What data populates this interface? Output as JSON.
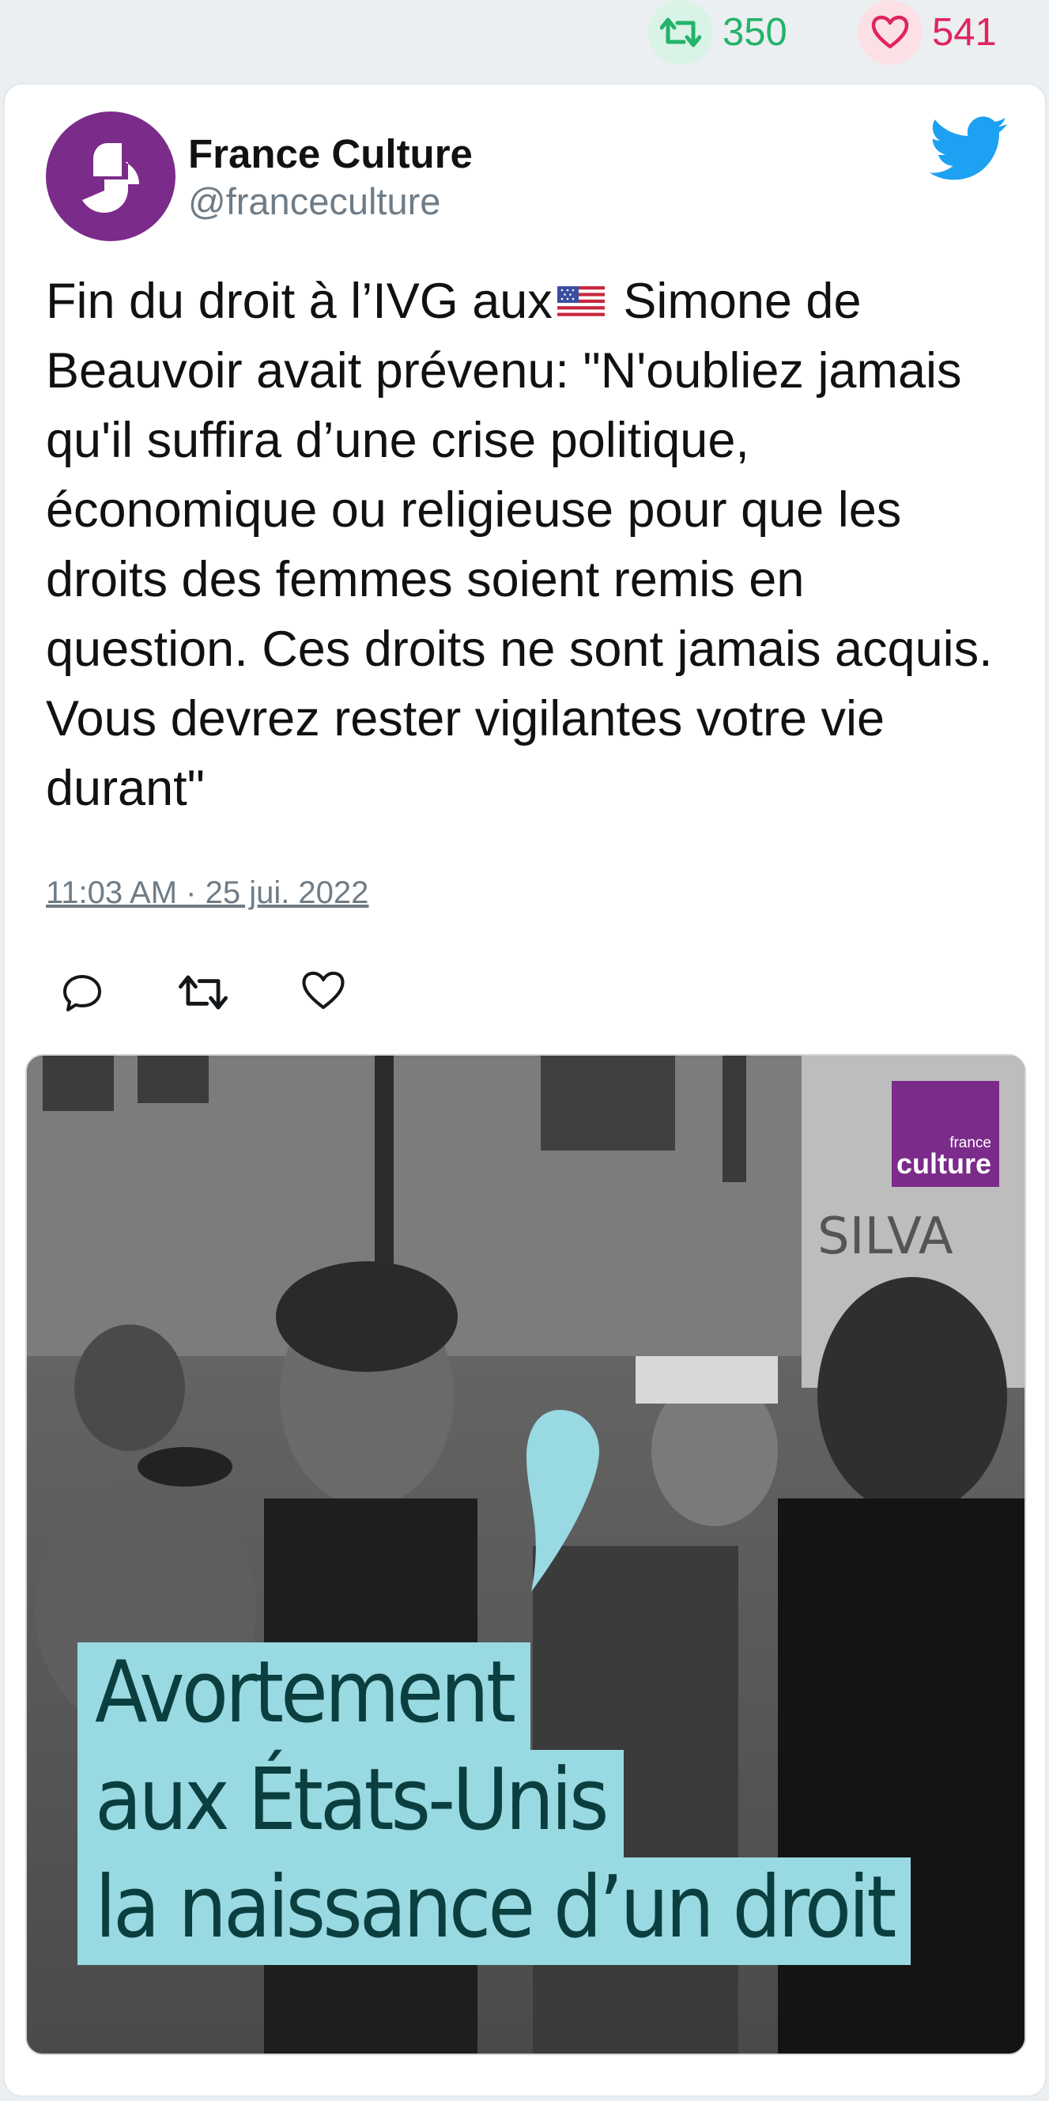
{
  "stats": {
    "retweets": "350",
    "likes": "541"
  },
  "tweet": {
    "author_name": "France Culture",
    "author_handle": "@franceculture",
    "text_before_flag": "Fin du droit à l’IVG aux",
    "text_after_flag": " Simone de Beauvoir avait prévenu: \"N'oubliez jamais qu'il suffira d’une crise politique, économique ou religieuse pour que les droits des femmes soient remis en question. Ces droits ne sont jamais acquis. Vous devrez rester vigilantes votre vie durant\"",
    "timestamp": "11:03 AM · 25 jui. 2022"
  },
  "media": {
    "logo_small": "france",
    "logo_big": "culture",
    "caption_lines": [
      "Avortement",
      "aux États-Unis",
      "la naissance d’un droit"
    ]
  },
  "colors": {
    "retweet": "#23b36b",
    "like": "#e0245e",
    "twitter_blue": "#1da1f2",
    "brand_purple": "#7b2b8a",
    "caption_bg": "#99d9e2"
  }
}
